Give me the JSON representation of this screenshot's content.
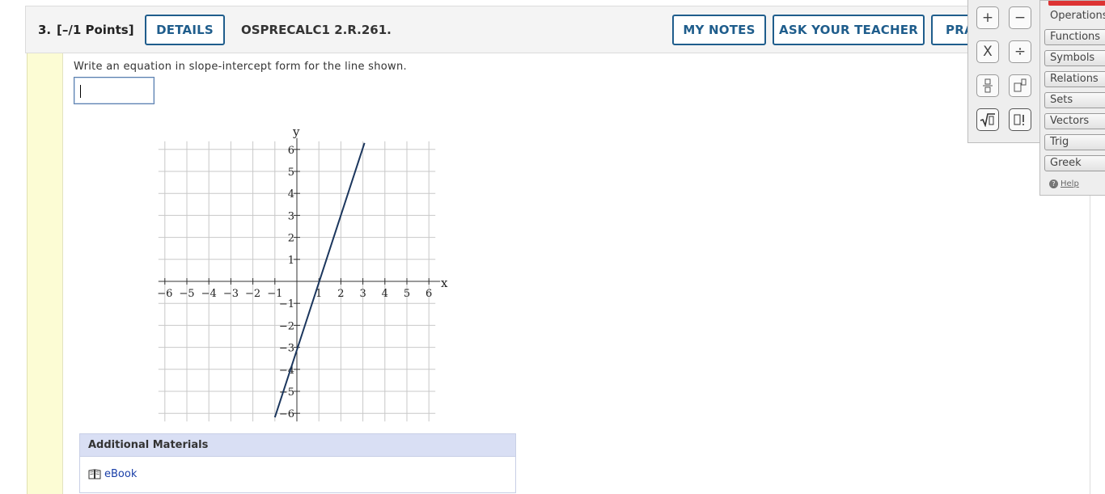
{
  "question": {
    "number": "3.",
    "points": "[–/1 Points]",
    "details_label": "DETAILS",
    "id": "OSPRECALC1 2.R.261.",
    "my_notes_label": "MY NOTES",
    "ask_teacher_label": "ASK YOUR TEACHER",
    "practice_label": "PRA",
    "prompt": "Write an equation in slope-intercept form for the line shown.",
    "answer_value": ""
  },
  "graph": {
    "x_axis_label": "x",
    "y_axis_label": "y",
    "x_ticks": [
      "−6",
      "−5",
      "−4",
      "−3",
      "−2",
      "−1",
      "1",
      "2",
      "3",
      "4",
      "5",
      "6"
    ],
    "y_ticks": [
      "6",
      "5",
      "4",
      "3",
      "2",
      "1",
      "−1",
      "−2",
      "−3",
      "−4",
      "−5",
      "−6"
    ],
    "line_color": "#1b365d",
    "xlim": [
      -6,
      6
    ],
    "ylim": [
      -6,
      6
    ],
    "line_points": [
      [
        -1,
        -6
      ],
      [
        3,
        6
      ]
    ]
  },
  "additional_materials": {
    "heading": "Additional Materials",
    "ebook_label": "eBook",
    "ebook_icon": "book-icon"
  },
  "palette": {
    "buttons": [
      {
        "symbol": "+",
        "icon": "plus-icon"
      },
      {
        "symbol": "−",
        "icon": "minus-icon"
      },
      {
        "symbol": "X",
        "icon": "multiply-icon"
      },
      {
        "symbol": "÷",
        "icon": "divide-icon"
      },
      {
        "symbol": "fraction",
        "icon": "fraction-icon"
      },
      {
        "symbol": "exponent",
        "icon": "exponent-icon"
      },
      {
        "symbol": "√▯",
        "icon": "sqrt-icon"
      },
      {
        "symbol": "▯!",
        "icon": "factorial-icon"
      }
    ],
    "active_tab": "Operations",
    "tabs": [
      "Functions",
      "Symbols",
      "Relations",
      "Sets",
      "Vectors",
      "Trig",
      "Greek"
    ],
    "help_label": "Help",
    "accent_color": "#d33333"
  }
}
